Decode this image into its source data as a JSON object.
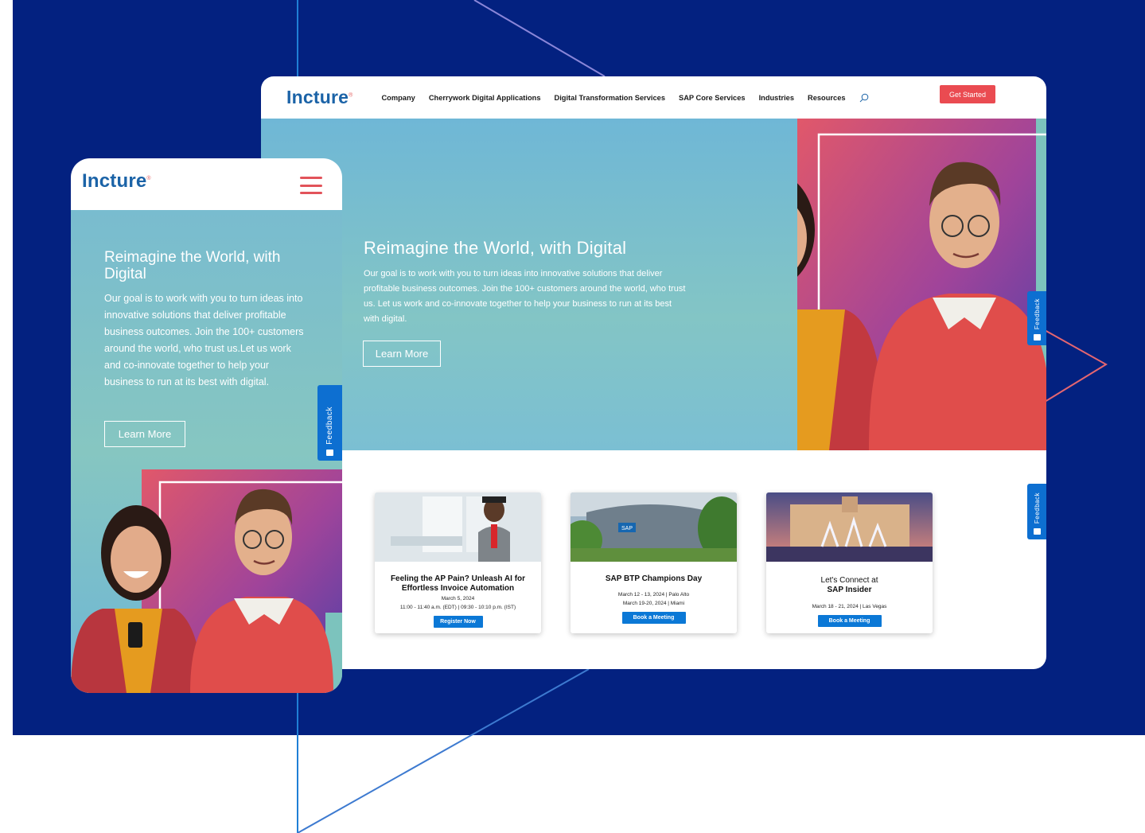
{
  "desktop": {
    "brand": "Incture",
    "brand_mark": "®",
    "nav": [
      "Company",
      "Cherrywork Digital Applications",
      "Digital Transformation Services",
      "SAP Core Services",
      "Industries",
      "Resources"
    ],
    "cta": "Get Started",
    "hero": {
      "title": "Reimagine the World, with Digital",
      "body": "Our goal is to work with you to turn ideas into innovative solutions that deliver profitable business outcomes. Join the 100+ customers around the world, who trust us. Let us work and co-innovate together to help your business to run at its best with digital.",
      "button": "Learn More"
    },
    "feedback": "Feedback",
    "cards": [
      {
        "title": "Feeling the AP Pain? Unleash AI for Effortless Invoice Automation",
        "date1": "March 5, 2024",
        "date2": "11:00 - 11:40 a.m. (EDT) | 09:30 - 10:10 p.m. (IST)",
        "button": "Register Now"
      },
      {
        "title": "SAP BTP Champions Day",
        "date1": "March 12 - 13, 2024 | Palo Alto",
        "date2": "March 19-20, 2024 | Miami",
        "button": "Book a Meeting",
        "img_label": "SAP"
      },
      {
        "title_line1": "Let's Connect at",
        "title_line2": "SAP Insider",
        "date1": "March 18 - 21, 2024 | Las Vegas",
        "button": "Book a Meeting"
      }
    ]
  },
  "mobile": {
    "brand": "Incture",
    "brand_mark": "®",
    "hero": {
      "title": "Reimagine the World, with Digital",
      "body": "Our goal is to work with you to turn ideas into innovative solutions that deliver profitable business outcomes. Join the 100+ customers around the world, who trust us.Let us work and co-innovate together to help your business to run at its best with digital.",
      "button": "Learn More"
    },
    "feedback": "Feedback"
  },
  "colors": {
    "navy": "#032180",
    "brand_blue": "#1b63a7",
    "accent_red": "#ea4b51",
    "button_blue": "#0b78d6"
  }
}
